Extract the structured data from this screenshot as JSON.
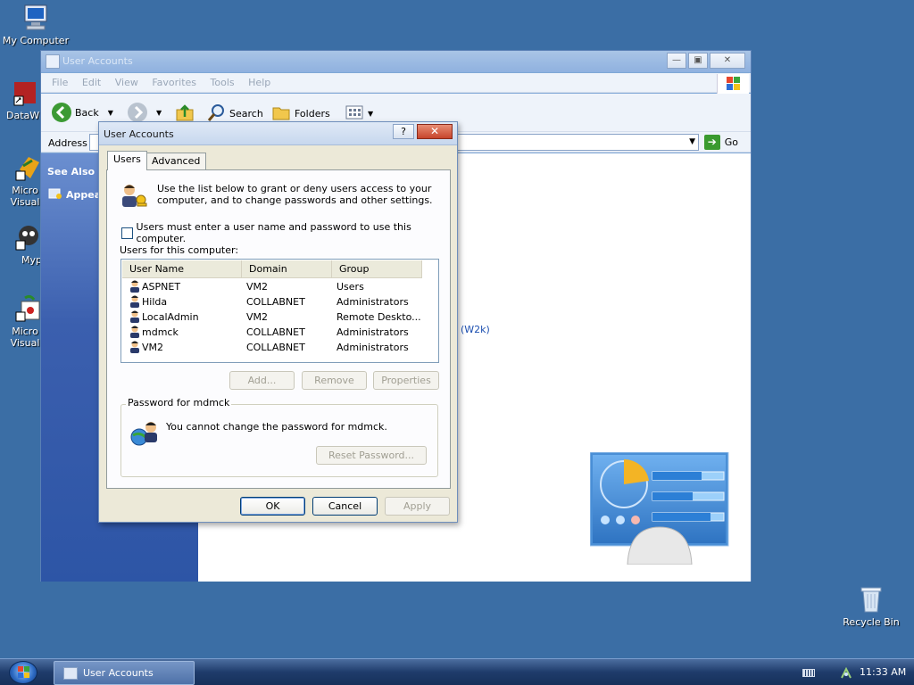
{
  "desktop": {
    "icons": [
      {
        "label": "My Computer",
        "icon": "computer-icon"
      },
      {
        "label": "DataWi",
        "icon": "shortcut-icon"
      },
      {
        "label": "Micro Visual",
        "icon": "shortcut-icon"
      },
      {
        "label": "Myp",
        "icon": "shortcut-icon"
      },
      {
        "label": "Micro Visual",
        "icon": "shortcut-icon"
      }
    ],
    "recycle_bin": "Recycle Bin"
  },
  "explorer": {
    "title": "User Accounts",
    "menu": [
      "File",
      "Edit",
      "View",
      "Favorites",
      "Tools",
      "Help"
    ],
    "toolbar": {
      "back": "Back",
      "search": "Search",
      "folders": "Folders"
    },
    "address_label": "Address",
    "go_label": "Go",
    "see_also": "See Also",
    "see_also_item": "Appeal",
    "main_link_fragment": "(W2k)"
  },
  "dialog": {
    "title": "User Accounts",
    "help_btn": "?",
    "close_btn": "✕",
    "tabs": [
      "Users",
      "Advanced"
    ],
    "active_tab": "Users",
    "intro": "Use the list below to grant or deny users access to your computer, and to change passwords and other settings.",
    "checkbox_label": "Users must enter a user name and password to use this computer.",
    "checkbox_checked": false,
    "users_label": "Users for this computer:",
    "columns": [
      "User Name",
      "Domain",
      "Group"
    ],
    "rows": [
      {
        "user": "ASPNET",
        "domain": "VM2",
        "group": "Users"
      },
      {
        "user": "Hilda",
        "domain": "COLLABNET",
        "group": "Administrators"
      },
      {
        "user": "LocalAdmin",
        "domain": "VM2",
        "group": "Remote Deskto..."
      },
      {
        "user": "mdmck",
        "domain": "COLLABNET",
        "group": "Administrators"
      },
      {
        "user": "VM2",
        "domain": "COLLABNET",
        "group": "Administrators"
      }
    ],
    "buttons": {
      "add": "Add...",
      "remove": "Remove",
      "properties": "Properties"
    },
    "password_group_title": "Password for mdmck",
    "password_text": "You cannot change the password for mdmck.",
    "reset_password": "Reset Password...",
    "ok": "OK",
    "cancel": "Cancel",
    "apply": "Apply"
  },
  "taskbar": {
    "task_label": "User Accounts",
    "clock": "11:33 AM"
  },
  "colors": {
    "desktop": "#3b6ea5",
    "dialog_bg": "#ece9d8",
    "close_red": "#c7452c",
    "link_blue": "#1c4fb0"
  }
}
